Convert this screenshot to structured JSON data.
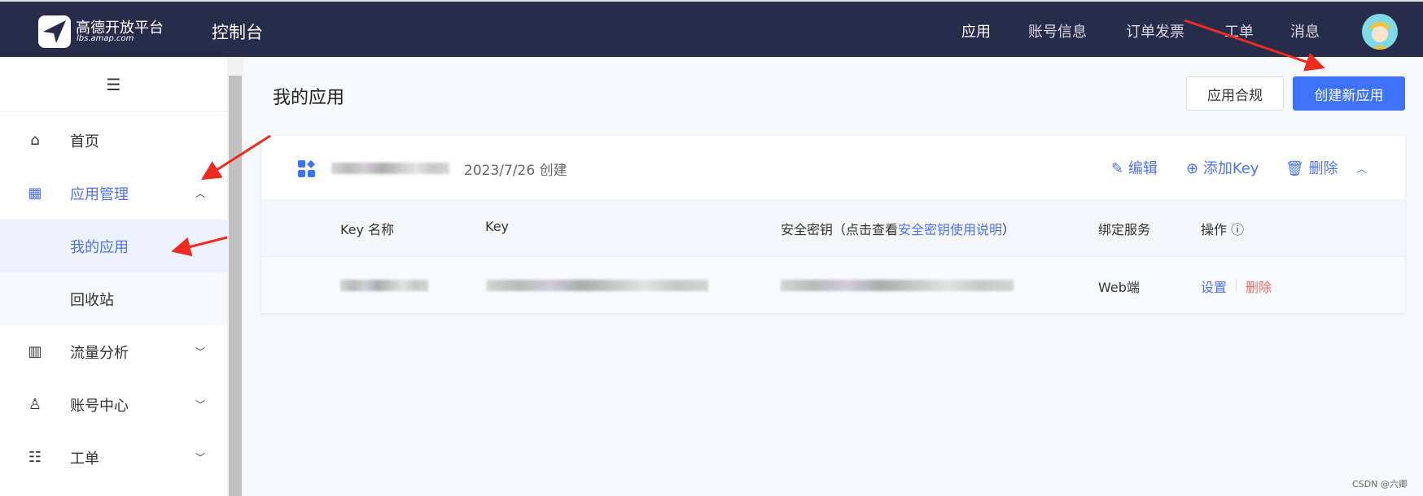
{
  "header": {
    "logo_title": "高德开放平台",
    "logo_url": "lbs.amap.com",
    "console": "控制台",
    "nav": [
      "应用",
      "账号信息",
      "订单发票",
      "工单",
      "消息"
    ]
  },
  "sidebar": {
    "menu_icon": "hamburger-icon",
    "items": [
      {
        "label": "首页",
        "icon": "home-icon"
      },
      {
        "label": "应用管理",
        "icon": "grid-icon"
      },
      {
        "label": "我的应用"
      },
      {
        "label": "回收站"
      },
      {
        "label": "流量分析",
        "icon": "chart-icon"
      },
      {
        "label": "账号中心",
        "icon": "user-icon"
      },
      {
        "label": "工单",
        "icon": "clipboard-icon"
      }
    ]
  },
  "page": {
    "title": "我的应用",
    "compliance_button": "应用合规",
    "create_button": "创建新应用"
  },
  "app_card": {
    "created": "2023/7/26 创建",
    "edit": "编辑",
    "add_key": "添加Key",
    "delete": "删除",
    "columns": {
      "key_name": "Key 名称",
      "key": "Key",
      "secret_prefix": "安全密钥（点击查看",
      "secret_link": "安全密钥使用说明",
      "secret_suffix": "）",
      "service": "绑定服务",
      "ops": "操作"
    },
    "rows": [
      {
        "service": "Web端",
        "settings": "设置",
        "delete": "删除"
      }
    ]
  },
  "watermark": "CSDN @六卿",
  "colors": {
    "header": "#282c4b",
    "accent": "#3f72fb",
    "danger": "#f56c6c",
    "annotation": "#f02a1f"
  }
}
